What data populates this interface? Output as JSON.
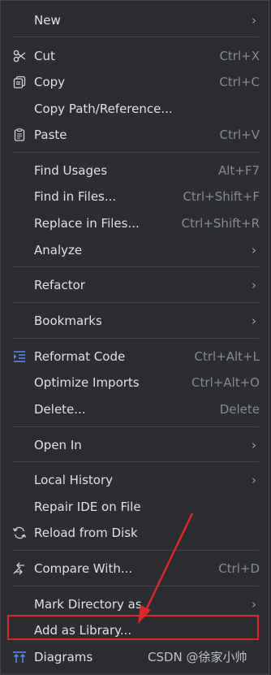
{
  "menu": {
    "new": {
      "label": "New"
    },
    "cut": {
      "label": "Cut",
      "shortcut": "Ctrl+X"
    },
    "copy": {
      "label": "Copy",
      "shortcut": "Ctrl+C"
    },
    "copy_path": {
      "label": "Copy Path/Reference..."
    },
    "paste": {
      "label": "Paste",
      "shortcut": "Ctrl+V"
    },
    "find_usages": {
      "label": "Find Usages",
      "shortcut": "Alt+F7"
    },
    "find_in_files": {
      "label": "Find in Files...",
      "shortcut": "Ctrl+Shift+F"
    },
    "replace_in_files": {
      "label": "Replace in Files...",
      "shortcut": "Ctrl+Shift+R"
    },
    "analyze": {
      "label": "Analyze"
    },
    "refactor": {
      "label": "Refactor"
    },
    "bookmarks": {
      "label": "Bookmarks"
    },
    "reformat_code": {
      "label": "Reformat Code",
      "shortcut": "Ctrl+Alt+L"
    },
    "optimize_imports": {
      "label": "Optimize Imports",
      "shortcut": "Ctrl+Alt+O"
    },
    "delete": {
      "label": "Delete...",
      "shortcut": "Delete"
    },
    "open_in": {
      "label": "Open In"
    },
    "local_history": {
      "label": "Local History"
    },
    "repair_ide": {
      "label": "Repair IDE on File"
    },
    "reload_from_disk": {
      "label": "Reload from Disk"
    },
    "compare_with": {
      "label": "Compare With...",
      "shortcut": "Ctrl+D"
    },
    "mark_directory_as": {
      "label": "Mark Directory as"
    },
    "add_as_library": {
      "label": "Add as Library..."
    },
    "diagrams": {
      "label": "Diagrams"
    }
  },
  "watermark": "CSDN @徐家小帅",
  "colors": {
    "background": "#2b2d30",
    "text": "#dfe1e5",
    "shortcut": "#868a91",
    "separator": "#43454a",
    "highlight_box": "#e0262a",
    "annotation_arrow": "#e0262a"
  }
}
